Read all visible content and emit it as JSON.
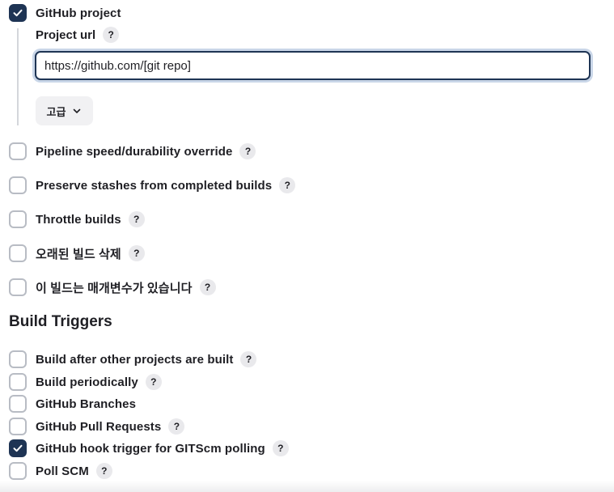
{
  "github_project": {
    "label": "GitHub project",
    "checked": true,
    "project_url_label": "Project url",
    "project_url_value": "https://github.com/[git repo]",
    "advanced_label": "고급"
  },
  "options": [
    {
      "label": "Pipeline speed/durability override",
      "checked": false,
      "help": "?"
    },
    {
      "label": "Preserve stashes from completed builds",
      "checked": false,
      "help": "?"
    },
    {
      "label": "Throttle builds",
      "checked": false,
      "help": "?"
    },
    {
      "label": "오래된 빌드 삭제",
      "checked": false,
      "help": "?"
    },
    {
      "label": "이 빌드는 매개변수가 있습니다",
      "checked": false,
      "help": "?"
    }
  ],
  "build_triggers": {
    "title": "Build Triggers",
    "items": [
      {
        "label": "Build after other projects are built",
        "checked": false,
        "help": "?"
      },
      {
        "label": "Build periodically",
        "checked": false,
        "help": "?"
      },
      {
        "label": "GitHub Branches",
        "checked": false,
        "help": ""
      },
      {
        "label": "GitHub Pull Requests",
        "checked": false,
        "help": "?"
      },
      {
        "label": "GitHub hook trigger for GITScm polling",
        "checked": true,
        "help": "?"
      },
      {
        "label": "Poll SCM",
        "checked": false,
        "help": "?"
      }
    ]
  },
  "help_glyph": "?",
  "colors": {
    "accent": "#1e3454",
    "checkbox_border": "#b8bcc4",
    "help_bg": "#e9e9ec",
    "button_bg": "#f1f1f3"
  }
}
